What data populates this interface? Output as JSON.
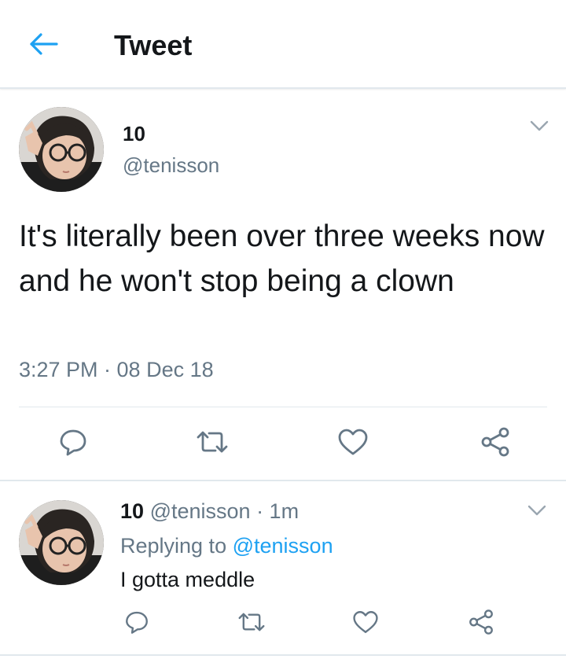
{
  "header": {
    "title": "Tweet",
    "back_icon": "arrow-left-icon",
    "accent_color": "#1da1f2"
  },
  "tweet": {
    "display_name": "10",
    "handle": "@tenisson",
    "text": "It's literally been over three weeks now and he won't stop being a clown",
    "timestamp": "3:27 PM · 08 Dec 18",
    "actions": [
      "reply-icon",
      "retweet-icon",
      "like-icon",
      "share-icon"
    ]
  },
  "reply": {
    "display_name": "10",
    "handle": "@tenisson",
    "time": "· 1m",
    "replying_prefix": "Replying to",
    "replying_to": "@tenisson",
    "text": "I gotta meddle",
    "actions": [
      "reply-icon",
      "retweet-icon",
      "like-icon",
      "share-icon"
    ]
  },
  "colors": {
    "text_primary": "#14171a",
    "text_secondary": "#657786",
    "link": "#1da1f2",
    "divider": "#e1e8ed"
  }
}
